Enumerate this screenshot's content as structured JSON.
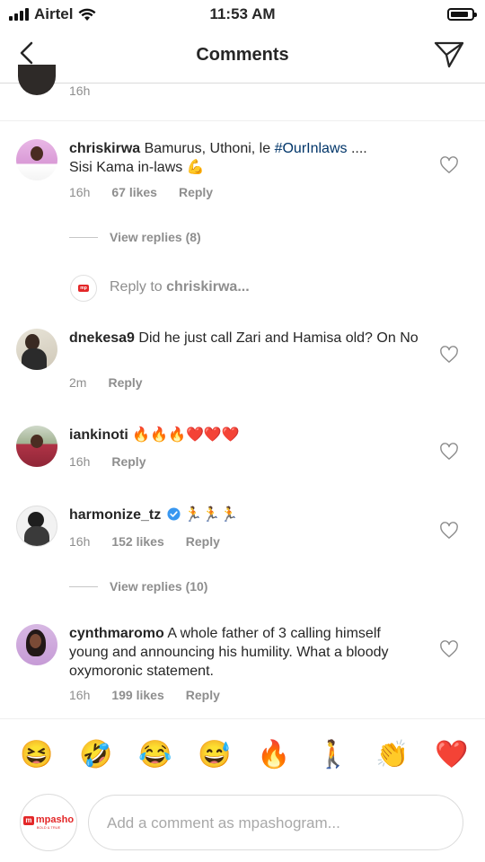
{
  "status": {
    "carrier": "Airtel",
    "time": "11:53 AM",
    "battery": 0.85
  },
  "nav": {
    "title": "Comments",
    "back_icon": "chevron-left-icon",
    "send_icon": "paper-plane-icon"
  },
  "prev_comment": {
    "time": "16h"
  },
  "comments": [
    {
      "username": "chriskirwa",
      "text": "Bamurus, Uthoni, le",
      "hashtag": "#OurInlaws",
      "text2": "....",
      "line2": "Sisi Kama in-laws 💪",
      "time": "16h",
      "likes": "67 likes",
      "reply": "Reply"
    },
    {
      "username": "dnekesa9",
      "text": "Did he just call Zari and Hamisa old? On No",
      "time": "2m",
      "reply": "Reply"
    },
    {
      "username": "iankinoti",
      "text": "🔥🔥🔥❤️❤️❤️",
      "time": "16h",
      "reply": "Reply"
    },
    {
      "username": "harmonize_tz",
      "text": "🏃🏃🏃",
      "time": "16h",
      "likes": "152 likes",
      "reply": "Reply"
    },
    {
      "username": "cynthmaromo",
      "text": "A whole father of 3 calling himself young and announcing his humility. What a bloody oxymoronic statement.",
      "time": "16h",
      "likes": "199 likes",
      "reply": "Reply"
    }
  ],
  "view_replies_1": "View replies (8)",
  "view_replies_2": "View replies (10)",
  "reply_prompt": {
    "prefix": "Reply to",
    "user": "chriskirwa..."
  },
  "reactions": [
    "😆",
    "🤣",
    "😂",
    "😅",
    "🔥",
    "🚶",
    "👏",
    "❤️"
  ],
  "composer": {
    "placeholder": "Add a comment as mpashogram...",
    "avatar_brand": "mpasho",
    "avatar_tagline": "BOLD & TRUE"
  },
  "colors": {
    "hashtag": "#003569",
    "verified": "#3897f0",
    "brand_red": "#e32728",
    "meta": "#8e8e8e"
  }
}
